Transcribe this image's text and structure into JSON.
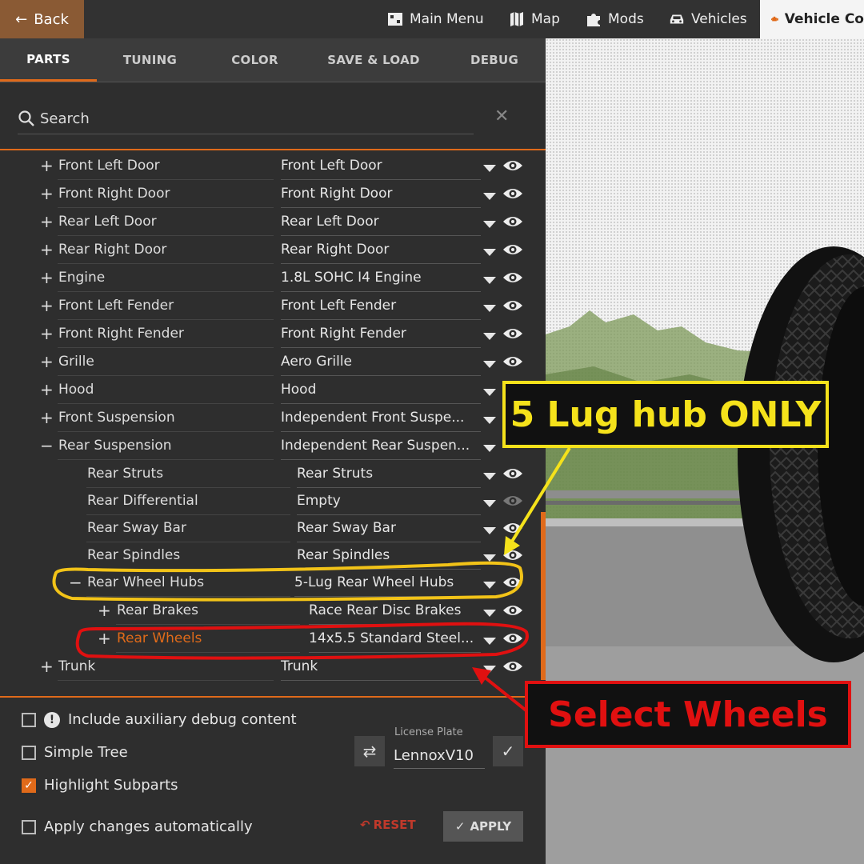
{
  "topbar": {
    "back_label": "Back",
    "items": [
      {
        "label": "Main Menu",
        "icon": "grid-icon"
      },
      {
        "label": "Map",
        "icon": "map-icon"
      },
      {
        "label": "Mods",
        "icon": "puzzle-icon"
      },
      {
        "label": "Vehicles",
        "icon": "car-icon"
      }
    ],
    "active_label": "Vehicle Co",
    "accent": "#e06a1a"
  },
  "tabs": [
    "PARTS",
    "TUNING",
    "COLOR",
    "SAVE & LOAD",
    "DEBUG"
  ],
  "active_tab": "PARTS",
  "search": {
    "placeholder": "Search"
  },
  "parts": [
    {
      "sign": "+",
      "name": "Front Left Door",
      "value": "Front Left Door"
    },
    {
      "sign": "+",
      "name": "Front Right Door",
      "value": "Front Right Door"
    },
    {
      "sign": "+",
      "name": "Rear Left Door",
      "value": "Rear Left Door"
    },
    {
      "sign": "+",
      "name": "Rear Right Door",
      "value": "Rear Right Door"
    },
    {
      "sign": "+",
      "name": "Engine",
      "value": "1.8L SOHC I4 Engine"
    },
    {
      "sign": "+",
      "name": "Front Left Fender",
      "value": "Front Left Fender"
    },
    {
      "sign": "+",
      "name": "Front Right Fender",
      "value": "Front Right Fender"
    },
    {
      "sign": "+",
      "name": "Grille",
      "value": "Aero Grille"
    },
    {
      "sign": "+",
      "name": "Hood",
      "value": "Hood"
    },
    {
      "sign": "+",
      "name": "Front Suspension",
      "value": "Independent Front Suspe..."
    },
    {
      "sign": "−",
      "name": "Rear Suspension",
      "value": "Independent Rear Suspen..."
    },
    {
      "sign": "",
      "name": "Rear Struts",
      "value": "Rear Struts"
    },
    {
      "sign": "",
      "name": "Rear Differential",
      "value": "Empty"
    },
    {
      "sign": "",
      "name": "Rear Sway Bar",
      "value": "Rear Sway Bar"
    },
    {
      "sign": "",
      "name": "Rear Spindles",
      "value": "Rear Spindles"
    },
    {
      "sign": "−",
      "name": "Rear Wheel Hubs",
      "value": "5-Lug Rear Wheel Hubs"
    },
    {
      "sign": "+",
      "name": "Rear Brakes",
      "value": "Race Rear Disc Brakes"
    },
    {
      "sign": "+",
      "name": "Rear Wheels",
      "value": "14x5.5 Standard Steel..."
    },
    {
      "sign": "+",
      "name": "Trunk",
      "value": "Trunk"
    }
  ],
  "options": {
    "aux_debug": "Include auxiliary debug content",
    "simple_tree": "Simple Tree",
    "highlight_subparts": "Highlight Subparts",
    "apply_auto": "Apply changes automatically"
  },
  "license": {
    "label": "License Plate",
    "value": "LennoxV10"
  },
  "buttons": {
    "reset": "RESET",
    "apply": "APPLY"
  },
  "annotations": {
    "hub_note": "5 Lug hub ONLY",
    "wheels_note": "Select Wheels"
  }
}
